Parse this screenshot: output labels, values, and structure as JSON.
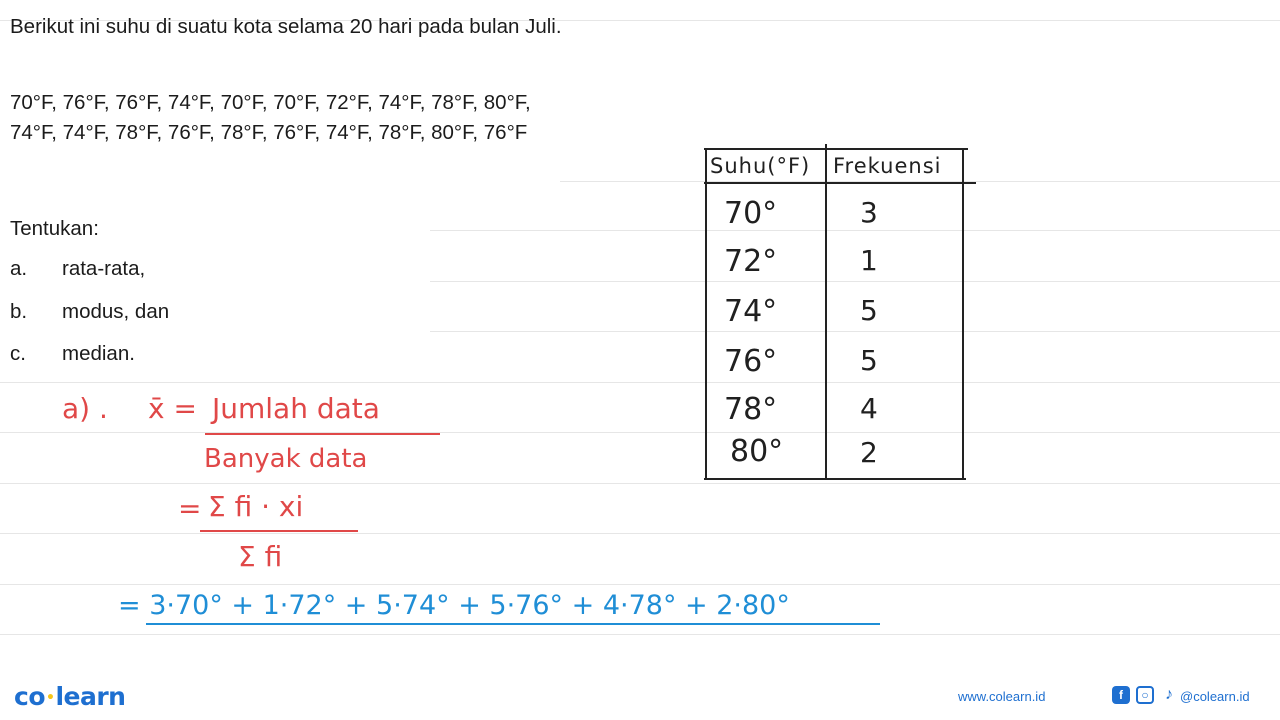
{
  "question": {
    "intro": "Berikut ini suhu di suatu kota selama 20 hari pada bulan Juli.",
    "data_text": "70°F, 76°F, 76°F, 74°F, 70°F, 70°F, 72°F, 74°F, 78°F, 80°F, 74°F, 74°F, 78°F, 76°F, 78°F, 76°F, 74°F, 78°F, 80°F, 76°F",
    "task": "Tentukan:",
    "options": [
      {
        "label": "a.",
        "text": "rata-rata,"
      },
      {
        "label": "b.",
        "text": "modus, dan"
      },
      {
        "label": "c.",
        "text": "median."
      }
    ]
  },
  "table": {
    "headers": [
      "Suhu(°F)",
      "Frekuensi"
    ],
    "rows": [
      {
        "suhu": "70°",
        "frekuensi": "3"
      },
      {
        "suhu": "72°",
        "frekuensi": "1"
      },
      {
        "suhu": "74°",
        "frekuensi": "5"
      },
      {
        "suhu": "76°",
        "frekuensi": "5"
      },
      {
        "suhu": "78°",
        "frekuensi": "4"
      },
      {
        "suhu": "80°",
        "frekuensi": "2"
      }
    ]
  },
  "solution": {
    "part_label": "a) .",
    "mean_symbol": "x̄ =",
    "numerator1": "Jumlah data",
    "denominator1": "Banyak data",
    "eq2": "=",
    "numerator2": "Σ fi · xi",
    "denominator2": "Σ fi",
    "eq3": "= 3·70° + 1·72° + 5·74° + 5·76° + 4·78° + 2·80°"
  },
  "footer": {
    "logo_left": "co",
    "logo_right": "learn",
    "website": "www.colearn.id",
    "social_handle": "@colearn.id",
    "icons": [
      "facebook-icon",
      "instagram-icon",
      "tiktok-icon"
    ],
    "brand_color": "#1e6fd0"
  }
}
